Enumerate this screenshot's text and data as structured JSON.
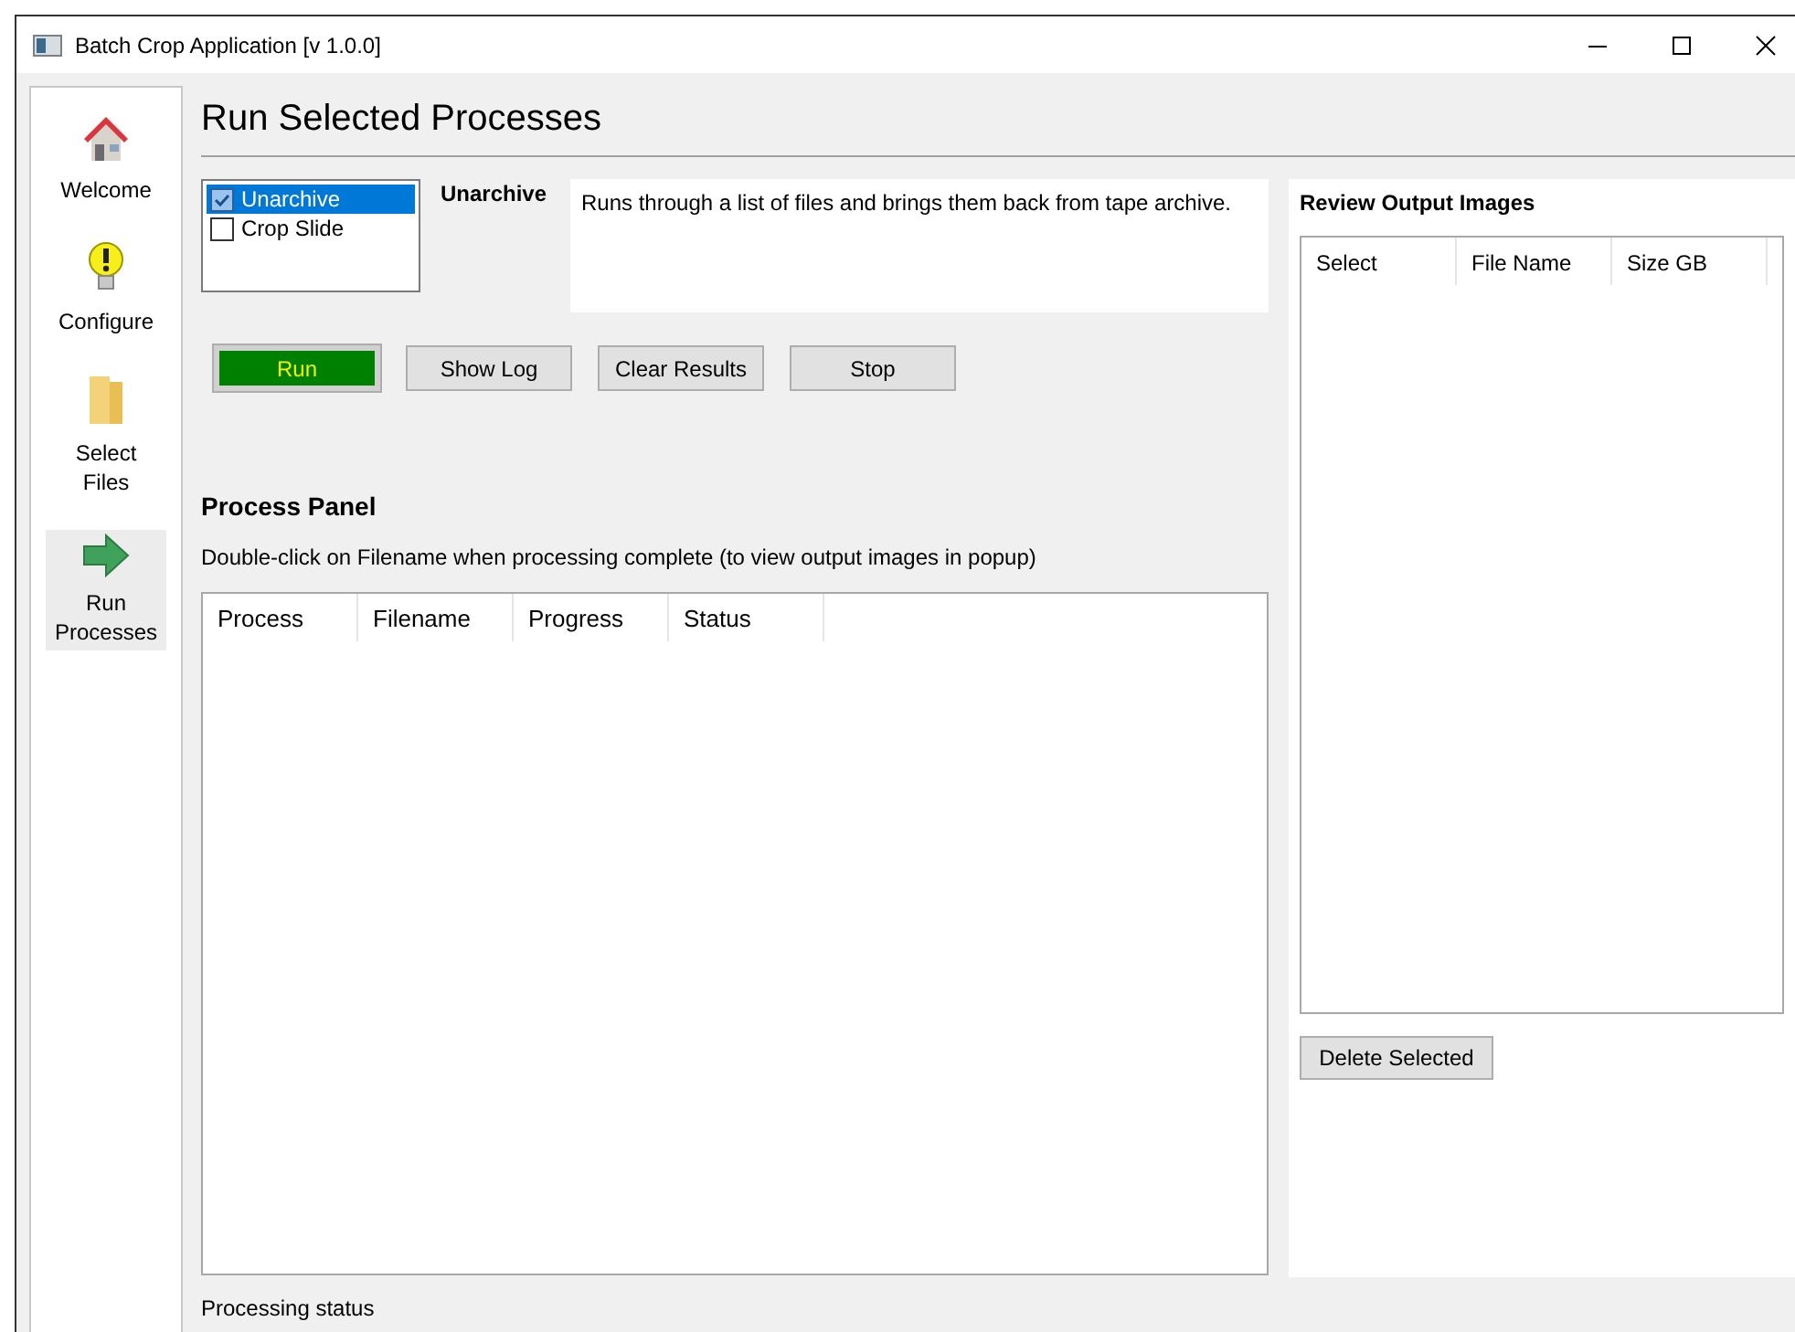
{
  "window": {
    "title": "Batch Crop Application [v 1.0.0]"
  },
  "sidebar": {
    "items": [
      {
        "label": "Welcome",
        "kind": "home",
        "selected": false
      },
      {
        "label": "Configure",
        "kind": "bulb",
        "selected": false
      },
      {
        "label": "Select Files",
        "kind": "folder",
        "selected": false
      },
      {
        "label": "Run Processes",
        "kind": "arrow",
        "selected": true
      }
    ]
  },
  "heading": "Run Selected Processes",
  "processes": [
    {
      "label": "Unarchive",
      "checked": true,
      "selected": true
    },
    {
      "label": "Crop Slide",
      "checked": false,
      "selected": false
    }
  ],
  "process_name": "Unarchive",
  "description": "Runs through a list of files and brings them back from tape archive.",
  "buttons": [
    {
      "label": "Run",
      "kind": "primary"
    },
    {
      "label": "Show Log",
      "kind": "normal"
    },
    {
      "label": "Clear Results",
      "kind": "normal"
    },
    {
      "label": "Stop",
      "kind": "normal"
    }
  ],
  "process_panel": {
    "title": "Process Panel",
    "hint": "Double-click on Filename when processing complete (to view output images in popup)",
    "columns": [
      "Process",
      "Filename",
      "Progress",
      "Status"
    ]
  },
  "review": {
    "title": "Review Output Images",
    "columns": [
      "Select",
      "File Name",
      "Size GB"
    ],
    "button": "Delete Selected"
  },
  "status_bar": "Processing status"
}
